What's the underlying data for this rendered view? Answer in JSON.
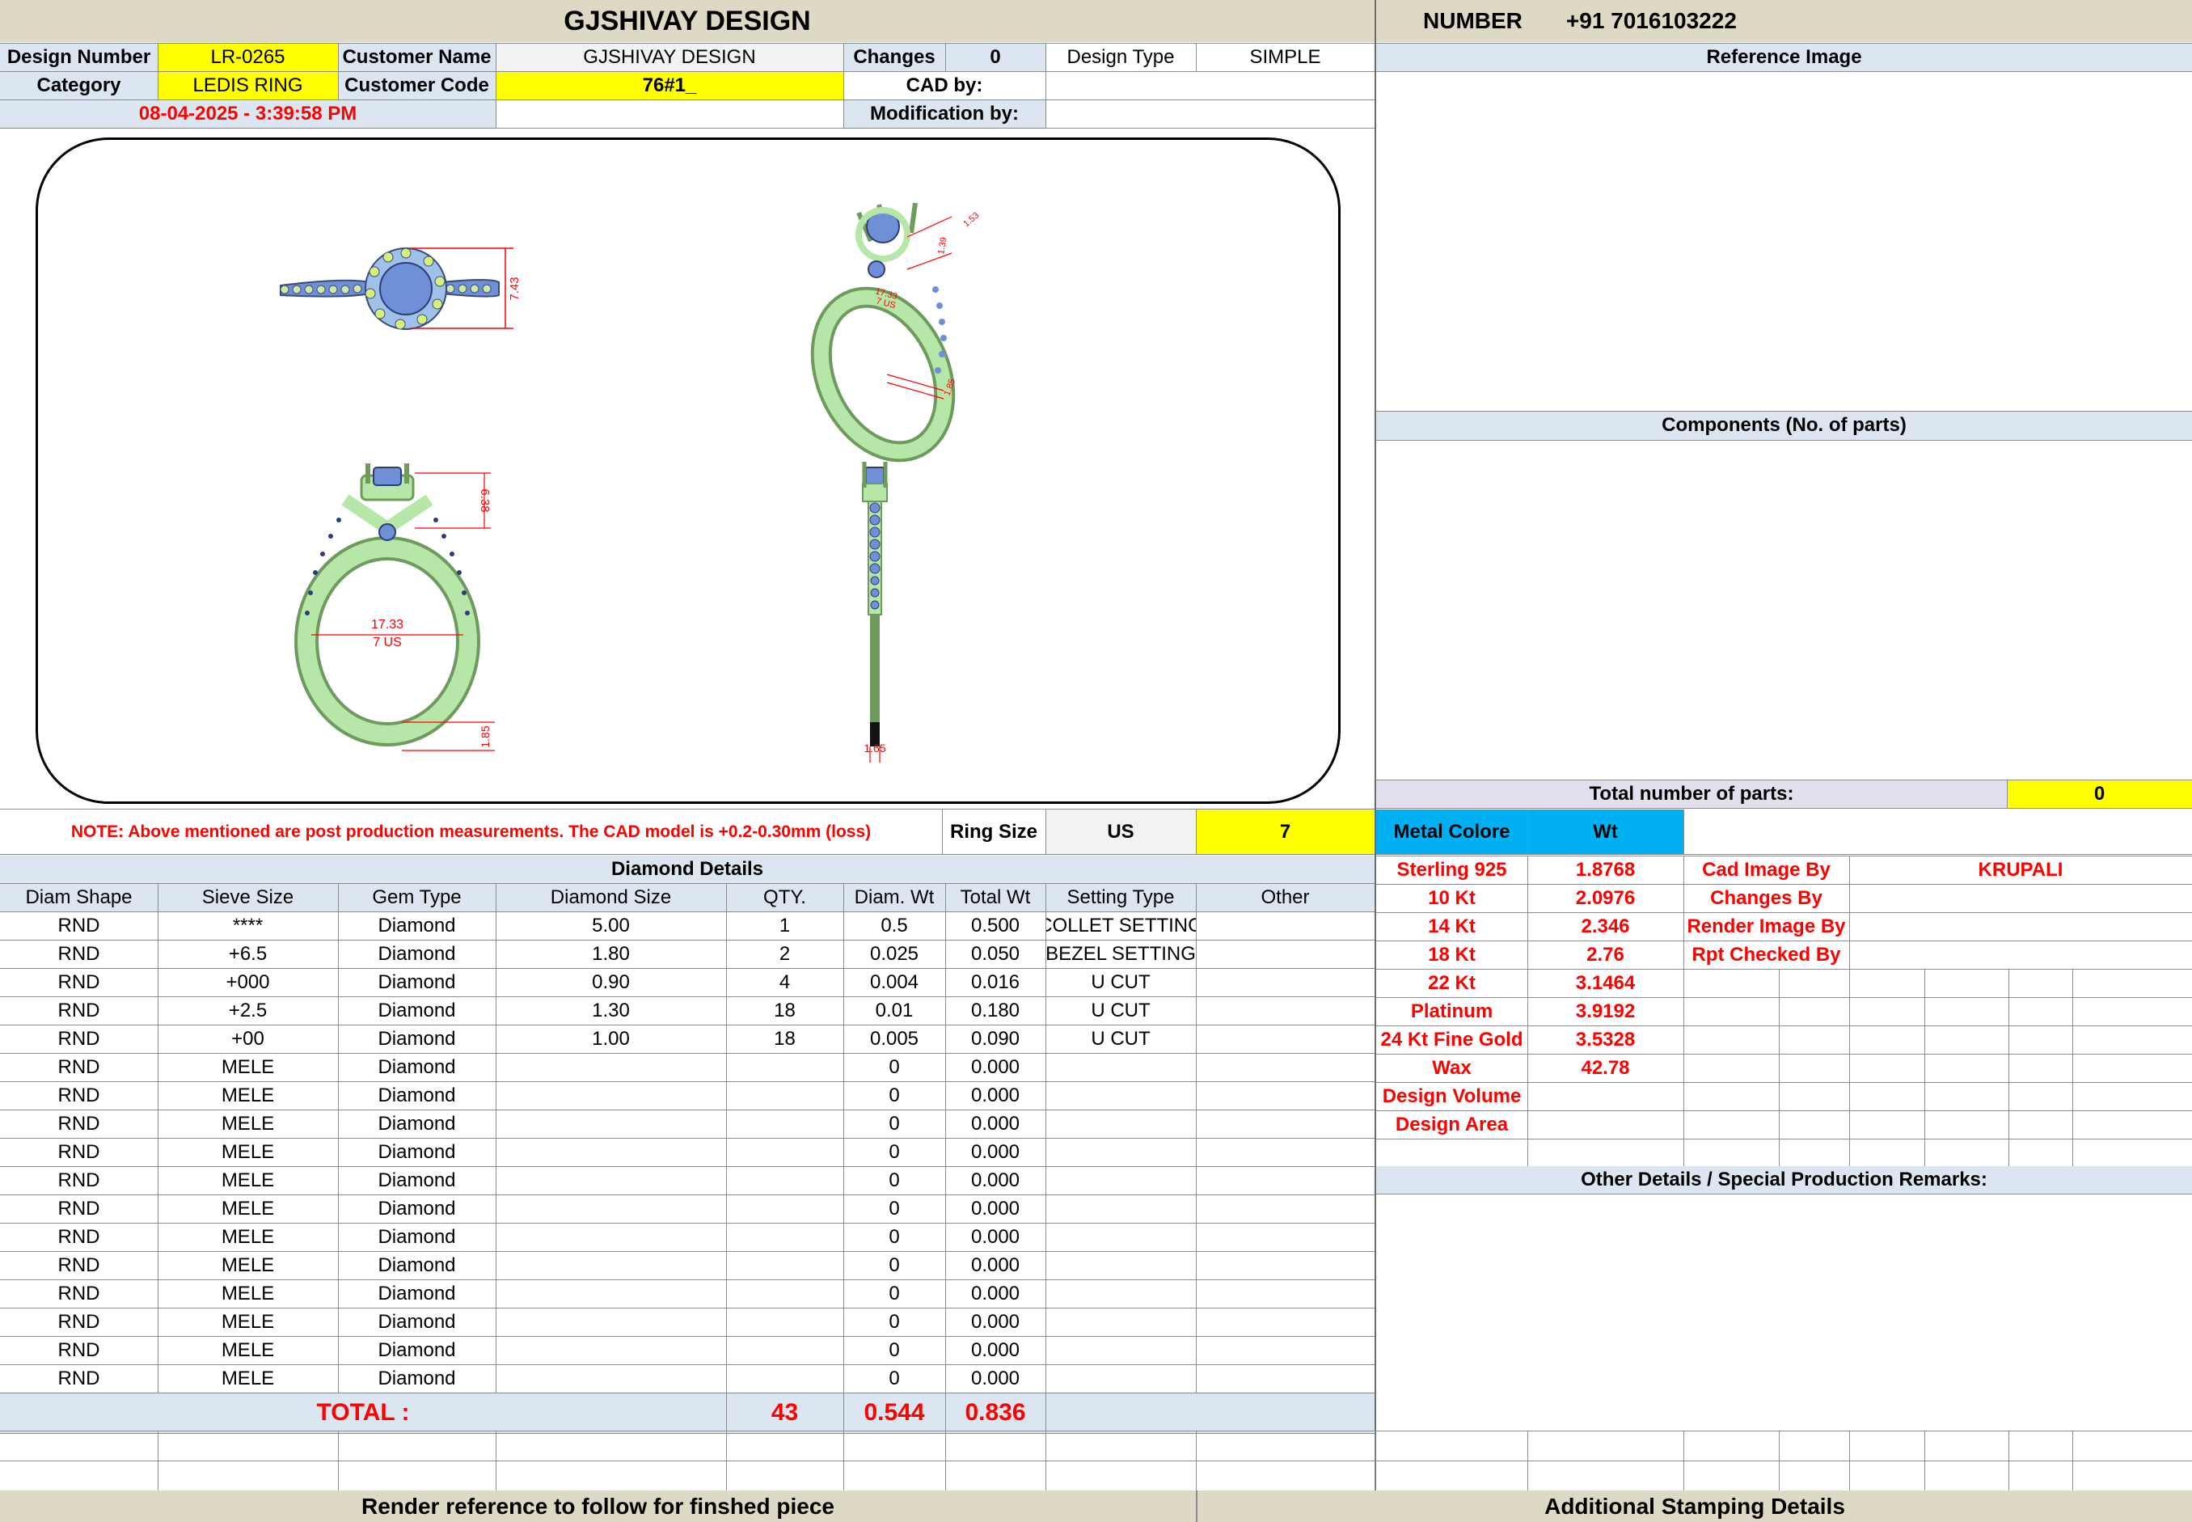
{
  "header": {
    "company": "GJSHIVAY DESIGN",
    "number_label": "NUMBER",
    "number_value": "+91 7016103222"
  },
  "info": {
    "design_number_label": "Design Number",
    "design_number": "LR-0265",
    "customer_name_label": "Customer Name",
    "customer_name": "GJSHIVAY DESIGN",
    "changes_label": "Changes",
    "changes": "0",
    "design_type_label": "Design Type",
    "design_type": "SIMPLE",
    "category_label": "Category",
    "category": "LEDIS RING",
    "customer_code_label": "Customer Code",
    "customer_code": "76#1_",
    "cad_by_label": "CAD by:",
    "cad_by": "",
    "datetime": "08-04-2025 - 3:39:58 PM",
    "modification_by_label": "Modification by:",
    "modification_by": ""
  },
  "drawing": {
    "dim_top_height": "7.43",
    "dim_persp_a": "1.39",
    "dim_persp_b": "1.53",
    "dim_persp_c": "17.33",
    "dim_persp_d": "7 US",
    "dim_persp_e": "1.85",
    "dim_front_height": "6.38",
    "dim_front_diameter": "17.33",
    "dim_front_size": "7 US",
    "dim_front_shank": "1.85",
    "dim_side_width": "1.65",
    "stone_color": "#6f8fd6",
    "metal_color": "#b6e6a8"
  },
  "note": "NOTE: Above mentioned are post production measurements. The CAD model is +0.2-0.30mm (loss)",
  "ring_size": {
    "label": "Ring Size",
    "unit": "US",
    "value": "7"
  },
  "reference_image_title": "Reference Image",
  "components_title": "Components (No. of parts)",
  "total_parts": {
    "label": "Total number of parts:",
    "value": "0"
  },
  "metal": {
    "header": {
      "color_label": "Metal Colore",
      "wt_label": "Wt"
    },
    "rows": [
      {
        "name": "Sterling 925",
        "wt": "1.8768"
      },
      {
        "name": "10 Kt",
        "wt": "2.0976"
      },
      {
        "name": "14 Kt",
        "wt": "2.346"
      },
      {
        "name": "18 Kt",
        "wt": "2.76"
      },
      {
        "name": "22 Kt",
        "wt": "3.1464"
      },
      {
        "name": "Platinum",
        "wt": "3.9192"
      },
      {
        "name": "24 Kt Fine Gold",
        "wt": "3.5328"
      },
      {
        "name": "Wax",
        "wt": "42.78"
      },
      {
        "name": "Design Volume",
        "wt": ""
      },
      {
        "name": "Design Area",
        "wt": ""
      }
    ]
  },
  "credits": [
    {
      "label": "Cad Image By",
      "value": "KRUPALI"
    },
    {
      "label": "Changes By",
      "value": ""
    },
    {
      "label": "Render Image By",
      "value": ""
    },
    {
      "label": "Rpt Checked By",
      "value": ""
    }
  ],
  "other_details_title": "Other Details / Special Production Remarks:",
  "diamond": {
    "title": "Diamond Details",
    "columns": [
      "Diam Shape",
      "Sieve Size",
      "Gem Type",
      "Diamond Size",
      "QTY.",
      "Diam. Wt",
      "Total Wt",
      "Setting Type",
      "Other"
    ],
    "rows": [
      [
        "RND",
        "****",
        "Diamond",
        "5.00",
        "1",
        "0.5",
        "0.500",
        "COLLET SETTING",
        ""
      ],
      [
        "RND",
        "+6.5",
        "Diamond",
        "1.80",
        "2",
        "0.025",
        "0.050",
        "BEZEL SETTING",
        ""
      ],
      [
        "RND",
        "+000",
        "Diamond",
        "0.90",
        "4",
        "0.004",
        "0.016",
        "U CUT",
        ""
      ],
      [
        "RND",
        "+2.5",
        "Diamond",
        "1.30",
        "18",
        "0.01",
        "0.180",
        "U CUT",
        ""
      ],
      [
        "RND",
        "+00",
        "Diamond",
        "1.00",
        "18",
        "0.005",
        "0.090",
        "U CUT",
        ""
      ],
      [
        "RND",
        "MELE",
        "Diamond",
        "",
        "",
        "0",
        "0.000",
        "",
        ""
      ],
      [
        "RND",
        "MELE",
        "Diamond",
        "",
        "",
        "0",
        "0.000",
        "",
        ""
      ],
      [
        "RND",
        "MELE",
        "Diamond",
        "",
        "",
        "0",
        "0.000",
        "",
        ""
      ],
      [
        "RND",
        "MELE",
        "Diamond",
        "",
        "",
        "0",
        "0.000",
        "",
        ""
      ],
      [
        "RND",
        "MELE",
        "Diamond",
        "",
        "",
        "0",
        "0.000",
        "",
        ""
      ],
      [
        "RND",
        "MELE",
        "Diamond",
        "",
        "",
        "0",
        "0.000",
        "",
        ""
      ],
      [
        "RND",
        "MELE",
        "Diamond",
        "",
        "",
        "0",
        "0.000",
        "",
        ""
      ],
      [
        "RND",
        "MELE",
        "Diamond",
        "",
        "",
        "0",
        "0.000",
        "",
        ""
      ],
      [
        "RND",
        "MELE",
        "Diamond",
        "",
        "",
        "0",
        "0.000",
        "",
        ""
      ],
      [
        "RND",
        "MELE",
        "Diamond",
        "",
        "",
        "0",
        "0.000",
        "",
        ""
      ],
      [
        "RND",
        "MELE",
        "Diamond",
        "",
        "",
        "0",
        "0.000",
        "",
        ""
      ],
      [
        "RND",
        "MELE",
        "Diamond",
        "",
        "",
        "0",
        "0.000",
        "",
        ""
      ]
    ],
    "total": {
      "label": "TOTAL :",
      "qty": "43",
      "diam_wt": "0.544",
      "total_wt": "0.836"
    }
  },
  "footer": {
    "render_reference": "Render reference to follow for finshed piece",
    "stamping": "Additional Stamping Details"
  }
}
